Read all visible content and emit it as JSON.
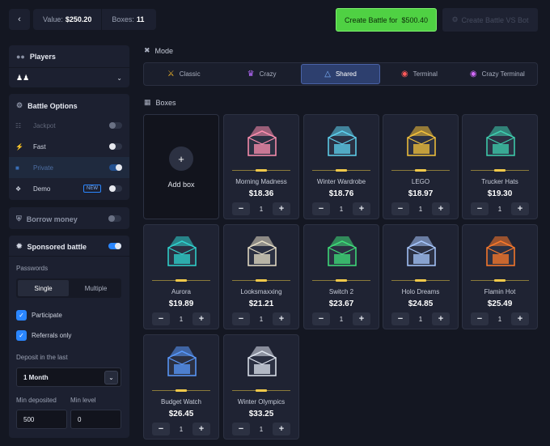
{
  "header": {
    "back_icon": "chevron-left-icon",
    "value_label": "Value:",
    "value_amount": "$250.20",
    "boxes_label": "Boxes:",
    "boxes_count": "11",
    "create_label": "Create Battle for",
    "create_amount": "$500.40",
    "bot_label": "Create Battle VS Bot"
  },
  "sidebar": {
    "players_title": "Players",
    "battle_options_title": "Battle Options",
    "options": [
      {
        "label": "Jackpot",
        "state": "off",
        "enabled": false
      },
      {
        "label": "Fast",
        "state": "off",
        "enabled": true
      },
      {
        "label": "Private",
        "state": "on",
        "enabled": false
      },
      {
        "label": "Demo",
        "badge": "NEW",
        "state": "off",
        "enabled": true
      }
    ],
    "borrow_title": "Borrow money",
    "sponsored_title": "Sponsored battle",
    "passwords_label": "Passwords",
    "single_label": "Single",
    "multiple_label": "Multiple",
    "participate_label": "Participate",
    "referrals_label": "Referrals only",
    "deposit_label": "Deposit in the last",
    "deposit_value": "1 Month",
    "min_deposited_label": "Min deposited",
    "min_level_label": "Min level",
    "min_deposited_value": "500",
    "min_level_value": "0"
  },
  "mode": {
    "title": "Mode",
    "tabs": [
      {
        "label": "Classic",
        "icon": "swords-icon",
        "color": "#f0b429"
      },
      {
        "label": "Crazy",
        "icon": "crown-icon",
        "color": "#b86bff"
      },
      {
        "label": "Shared",
        "icon": "triangle-icon",
        "color": "#7fb5ff"
      },
      {
        "label": "Terminal",
        "icon": "target-icon",
        "color": "#ff5a5a"
      },
      {
        "label": "Crazy Terminal",
        "icon": "target-icon",
        "color": "#d46bff"
      }
    ],
    "active": "Shared"
  },
  "boxes": {
    "title": "Boxes",
    "add_label": "Add box",
    "items": [
      {
        "name": "Morning Madness",
        "price": "$18.36",
        "qty": "1",
        "color": "#ff8fb0"
      },
      {
        "name": "Winter Wardrobe",
        "price": "$18.76",
        "qty": "1",
        "color": "#5fd3f0"
      },
      {
        "name": "LEGO",
        "price": "$18.97",
        "qty": "1",
        "color": "#f5c33b"
      },
      {
        "name": "Trucker Hats",
        "price": "$19.30",
        "qty": "1",
        "color": "#3fd1b0"
      },
      {
        "name": "Aurora",
        "price": "$19.89",
        "qty": "1",
        "color": "#2fd6d0"
      },
      {
        "name": "Looksmaxxing",
        "price": "$21.21",
        "qty": "1",
        "color": "#e8e0c8"
      },
      {
        "name": "Switch 2",
        "price": "$23.67",
        "qty": "1",
        "color": "#3fe07a"
      },
      {
        "name": "Holo Dreams",
        "price": "$24.85",
        "qty": "1",
        "color": "#a8c8ff"
      },
      {
        "name": "Flamin Hot",
        "price": "$25.49",
        "qty": "1",
        "color": "#ff7a2a"
      },
      {
        "name": "Budget Watch",
        "price": "$26.45",
        "qty": "1",
        "color": "#5a9aff"
      },
      {
        "name": "Winter Olympics",
        "price": "$33.25",
        "qty": "1",
        "color": "#e0e6f0"
      }
    ]
  }
}
